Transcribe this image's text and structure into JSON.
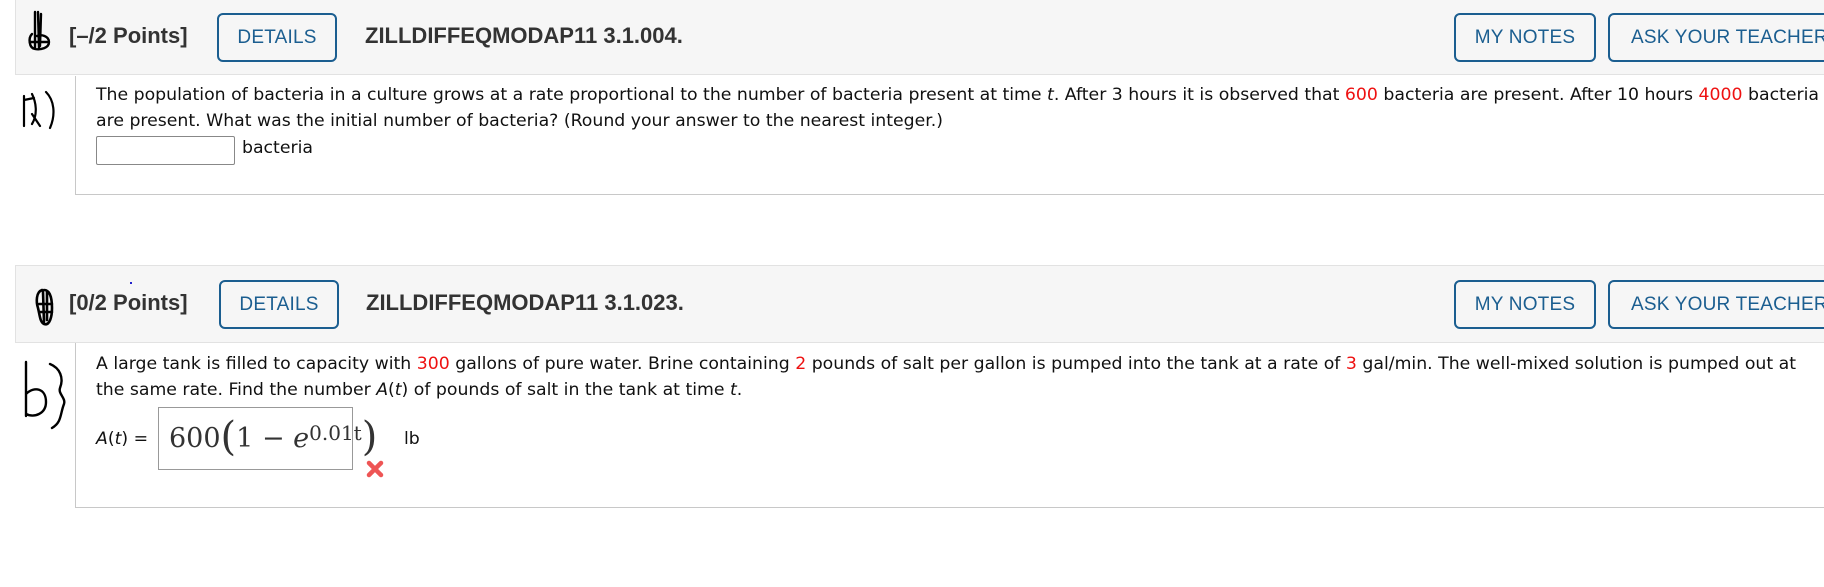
{
  "questions": [
    {
      "annotation": "a)",
      "points": "[–/2 Points]",
      "details_label": "DETAILS",
      "code": "ZILLDIFFEQMODAP11 3.1.004.",
      "my_notes_label": "MY NOTES",
      "ask_teacher_label": "ASK YOUR TEACHER",
      "text": {
        "p1": "The population of bacteria in a culture grows at a rate proportional to the number of bacteria present at time ",
        "var_t": "t",
        "p2": ". After 3 hours it is observed that ",
        "v1": "600",
        "p3": " bacteria are present. After 10 hours ",
        "v2": "4000",
        "p4": " bacteria are present. What was the initial number of bacteria? (Round your answer to the nearest integer.)"
      },
      "answer": {
        "value": "",
        "unit": "bacteria"
      }
    },
    {
      "annotation": "b)",
      "points": "[0/2 Points]",
      "details_label": "DETAILS",
      "code": "ZILLDIFFEQMODAP11 3.1.023.",
      "my_notes_label": "MY NOTES",
      "ask_teacher_label": "ASK YOUR TEACHER",
      "text": {
        "p1": "A large tank is filled to capacity with ",
        "v1": "300",
        "p2": " gallons of pure water. Brine containing ",
        "v2": "2",
        "p3": " pounds of salt per gallon is pumped into the tank at a rate of ",
        "v3": "3",
        "p4": " gal/min. The well-mixed solution is pumped out at the same rate. Find the number ",
        "A": "A",
        "p5": "(",
        "t1": "t",
        "p6": ") of pounds of salt in the tank at time ",
        "t2": "t",
        "p7": "."
      },
      "answer": {
        "label_A": "A",
        "label_open": "(",
        "label_t": "t",
        "label_close": ") =",
        "math": {
          "coef": "600",
          "one": "1",
          "minus": "−",
          "e": "e",
          "exponent": "0.01t"
        },
        "unit": "lb",
        "status": "incorrect",
        "status_icon": "x-mark-icon"
      }
    }
  ],
  "colors": {
    "accent": "#1b5e90",
    "given_value": "#ee1111",
    "incorrect": "#ee5555",
    "header_bg": "#f6f6f6"
  }
}
